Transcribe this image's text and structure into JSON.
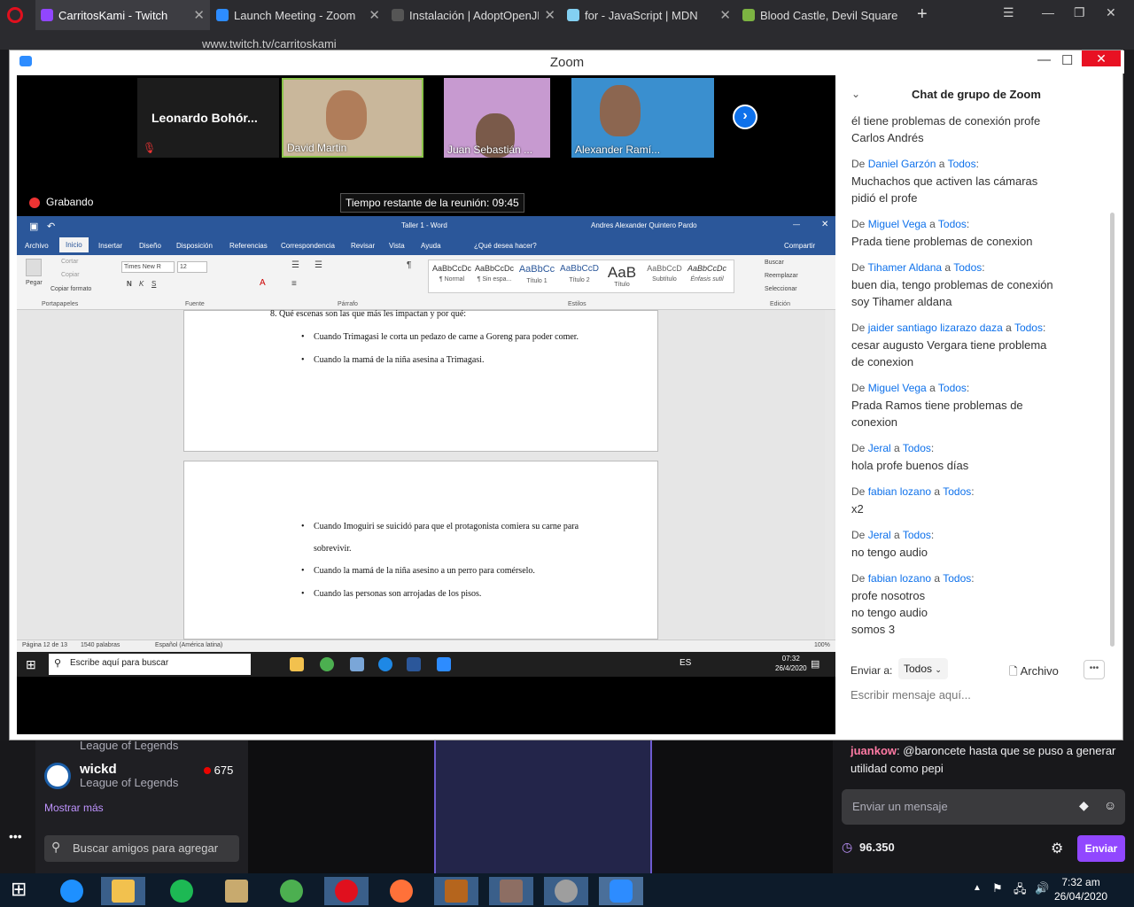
{
  "browser": {
    "tabs": [
      {
        "title": "CarritosKami - Twitch",
        "color": "#9146ff"
      },
      {
        "title": "Launch Meeting - Zoom",
        "color": "#2d8cff"
      },
      {
        "title": "Instalación | AdoptOpenJDK",
        "color": "#555555"
      },
      {
        "title": "for - JavaScript | MDN",
        "color": "#83d0f2"
      },
      {
        "title": "Blood Castle, Devil Square",
        "color": "#7cb342"
      }
    ],
    "url": "www.twitch.tv/carritoskami"
  },
  "zoom": {
    "title": "Zoom",
    "participants": [
      {
        "name": "Leonardo Bohór...",
        "muted": true
      },
      {
        "name": "David Martin"
      },
      {
        "name": "Juan Sebastián ..."
      },
      {
        "name": "Alexander Ramí..."
      }
    ],
    "recording": "Grabando",
    "time_remaining": "Tiempo restante de la reunión: 09:45"
  },
  "word": {
    "doc_title": "Taller 1 - Word",
    "user": "Andres Alexander Quintero Pardo",
    "menu": [
      "Archivo",
      "Inicio",
      "Insertar",
      "Diseño",
      "Disposición",
      "Referencias",
      "Correspondencia",
      "Revisar",
      "Vista",
      "Ayuda",
      "¿Qué desea hacer?"
    ],
    "share": "Compartir",
    "clipboard": {
      "paste": "Pegar",
      "cut": "Cortar",
      "copy": "Copiar",
      "format": "Copiar formato",
      "group": "Portapapeles"
    },
    "font": {
      "name": "Times New R",
      "size": "12",
      "group": "Fuente"
    },
    "paragraph_group": "Párrafo",
    "styles": [
      {
        "sample": "AaBbCcDc",
        "name": "¶ Normal"
      },
      {
        "sample": "AaBbCcDc",
        "name": "¶ Sin espa..."
      },
      {
        "sample": "AaBbCc",
        "name": "Título 1"
      },
      {
        "sample": "AaBbCcD",
        "name": "Título 2"
      },
      {
        "sample": "AaB",
        "name": "Título"
      },
      {
        "sample": "AaBbCcD",
        "name": "Subtítulo"
      },
      {
        "sample": "AaBbCcDc",
        "name": "Énfasis sutil"
      }
    ],
    "styles_group": "Estilos",
    "editing": {
      "find": "Buscar",
      "replace": "Reemplazar",
      "select": "Seleccionar",
      "group": "Edición"
    },
    "page1": {
      "question": "8.   Qué escenas son las que más les impactan y por qué:",
      "bullets": [
        "Cuando Trimagasi le corta un pedazo de carne a Goreng para poder comer.",
        "Cuando la mamá de la niña asesina a Trimagasi."
      ]
    },
    "page2": {
      "bullets": [
        "Cuando Imoguiri se suicidó para que el protagonista comiera su carne para",
        "sobrevivir.",
        "Cuando la mamá de la niña asesino a un perro para comérselo.",
        "Cuando las personas son arrojadas de los pisos."
      ]
    },
    "status": {
      "page": "Página 12 de 13",
      "words": "1540 palabras",
      "lang": "Español (América latina)",
      "zoom": "100%"
    }
  },
  "shared_taskbar": {
    "search": "Escribe aquí para buscar",
    "lang": "ES",
    "time": "07:32",
    "date": "26/4/2020"
  },
  "zoom_chat": {
    "header": "Chat de grupo de Zoom",
    "messages": [
      {
        "from": "",
        "to": "",
        "lines": [
          "él tiene problemas de conexión profe",
          "Carlos Andrés"
        ]
      },
      {
        "from": "Daniel Garzón",
        "to": "Todos",
        "lines": [
          "Muchachos que activen las cámaras",
          "pidió el profe"
        ]
      },
      {
        "from": "Miguel Vega",
        "to": "Todos",
        "lines": [
          "Prada tiene problemas de conexion"
        ]
      },
      {
        "from": "Tihamer Aldana",
        "to": "Todos",
        "lines": [
          "buen dia,  tengo problemas de conexión",
          "soy Tihamer aldana"
        ]
      },
      {
        "from": "jaider santiago lizarazo daza",
        "to": "Todos",
        "lines": [
          "cesar augusto Vergara tiene problema",
          "de conexion"
        ]
      },
      {
        "from": "Miguel Vega",
        "to": "Todos",
        "lines": [
          "Prada Ramos tiene problemas de",
          "conexion"
        ]
      },
      {
        "from": "Jeral",
        "to": "Todos",
        "lines": [
          "hola profe buenos días"
        ]
      },
      {
        "from": "fabian lozano",
        "to": "Todos",
        "lines": [
          "x2"
        ]
      },
      {
        "from": "Jeral",
        "to": "Todos",
        "lines": [
          "no tengo audio"
        ]
      },
      {
        "from": "fabian lozano",
        "to": "Todos",
        "lines": [
          "profe nosotros",
          "no tengo audio",
          "somos 3"
        ]
      }
    ],
    "de": "De",
    "a": "a",
    "send_to_label": "Enviar a:",
    "send_to_value": "Todos",
    "file": "Archivo",
    "placeholder": "Escribir mensaje aquí..."
  },
  "twitch": {
    "partial_game": "League of Legends",
    "channel": {
      "name": "wickd",
      "game": "League of Legends",
      "viewers": "675"
    },
    "show_more": "Mostrar más",
    "friend_search": "Buscar amigos para agregar",
    "chat_user": "juankow",
    "chat_text": "@baroncete hasta que se puso a generar utilidad como pepi",
    "send_placeholder": "Enviar un mensaje",
    "points": "96.350",
    "send": "Enviar"
  },
  "taskbar": {
    "time": "7:32 am",
    "date": "26/04/2020"
  }
}
